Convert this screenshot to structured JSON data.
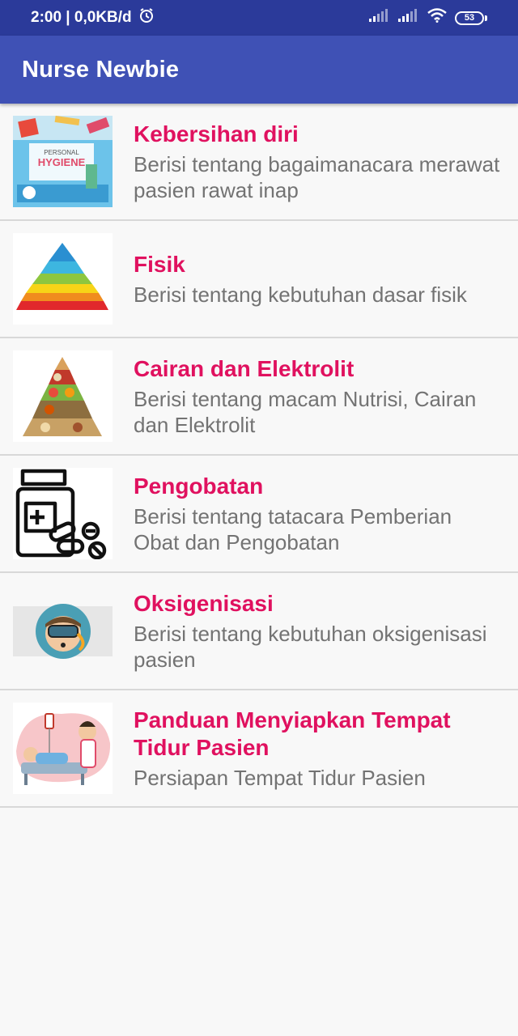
{
  "status_bar": {
    "time_speed": "2:00 | 0,0KB/d",
    "battery": "53"
  },
  "app_bar": {
    "title": "Nurse Newbie"
  },
  "items": [
    {
      "title": "Kebersihan diri",
      "description": "Berisi tentang bagaimanacara merawat pasien rawat inap",
      "image_icon": "personal-hygiene-image",
      "image_text": "PERSONAL HYGIENE"
    },
    {
      "title": "Fisik",
      "description": "Berisi tentang kebutuhan dasar fisik",
      "image_icon": "maslow-pyramid-image"
    },
    {
      "title": "Cairan dan Elektrolit",
      "description": "Berisi tentang macam Nutrisi, Cairan dan Elektrolit",
      "image_icon": "food-pyramid-image"
    },
    {
      "title": "Pengobatan",
      "description": "Berisi tentang tatacara Pemberian Obat dan Pengobatan",
      "image_icon": "medicine-bottle-image"
    },
    {
      "title": "Oksigenisasi",
      "description": "Berisi tentang kebutuhan oksigenisasi pasien",
      "image_icon": "diver-mask-image"
    },
    {
      "title": "Panduan Menyiapkan Tempat Tidur Pasien",
      "description": "Persiapan Tempat Tidur Pasien",
      "image_icon": "nurse-patient-bed-image"
    }
  ],
  "colors": {
    "status_bar": "#2b3a9a",
    "app_bar": "#3f51b5",
    "title_accent": "#e0115f",
    "description": "#737373"
  }
}
